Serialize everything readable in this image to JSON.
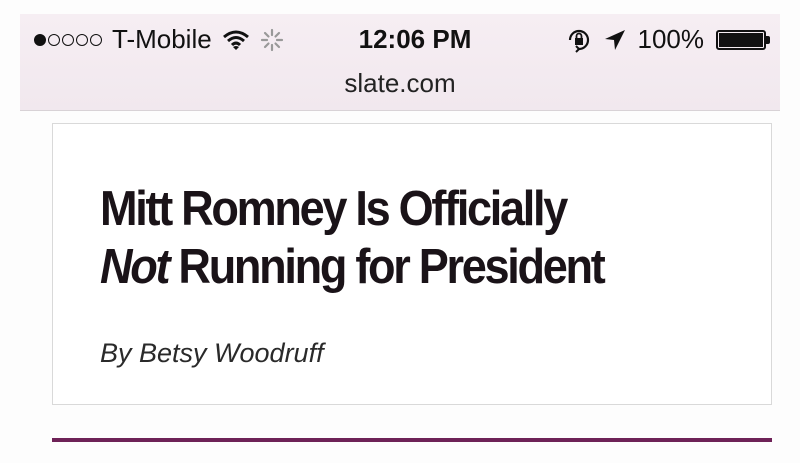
{
  "status_bar": {
    "signal_total": 5,
    "signal_filled": 1,
    "carrier": "T-Mobile",
    "time": "12:06 PM",
    "battery_percent": "100%",
    "battery_level": 1.0
  },
  "browser": {
    "url": "slate.com"
  },
  "article": {
    "headline_line1": "Mitt Romney Is Officially",
    "headline_emphasis": "Not",
    "headline_line2_rest": " Running for President",
    "byline": "By Betsy Woodruff"
  },
  "colors": {
    "status_bar_bg": "#f4ecf1",
    "accent_line": "#6e2257",
    "headline_text": "#1a1318"
  },
  "icons": [
    "wifi-icon",
    "activity-spinner-icon",
    "rotation-lock-icon",
    "location-arrow-icon",
    "battery-icon"
  ]
}
